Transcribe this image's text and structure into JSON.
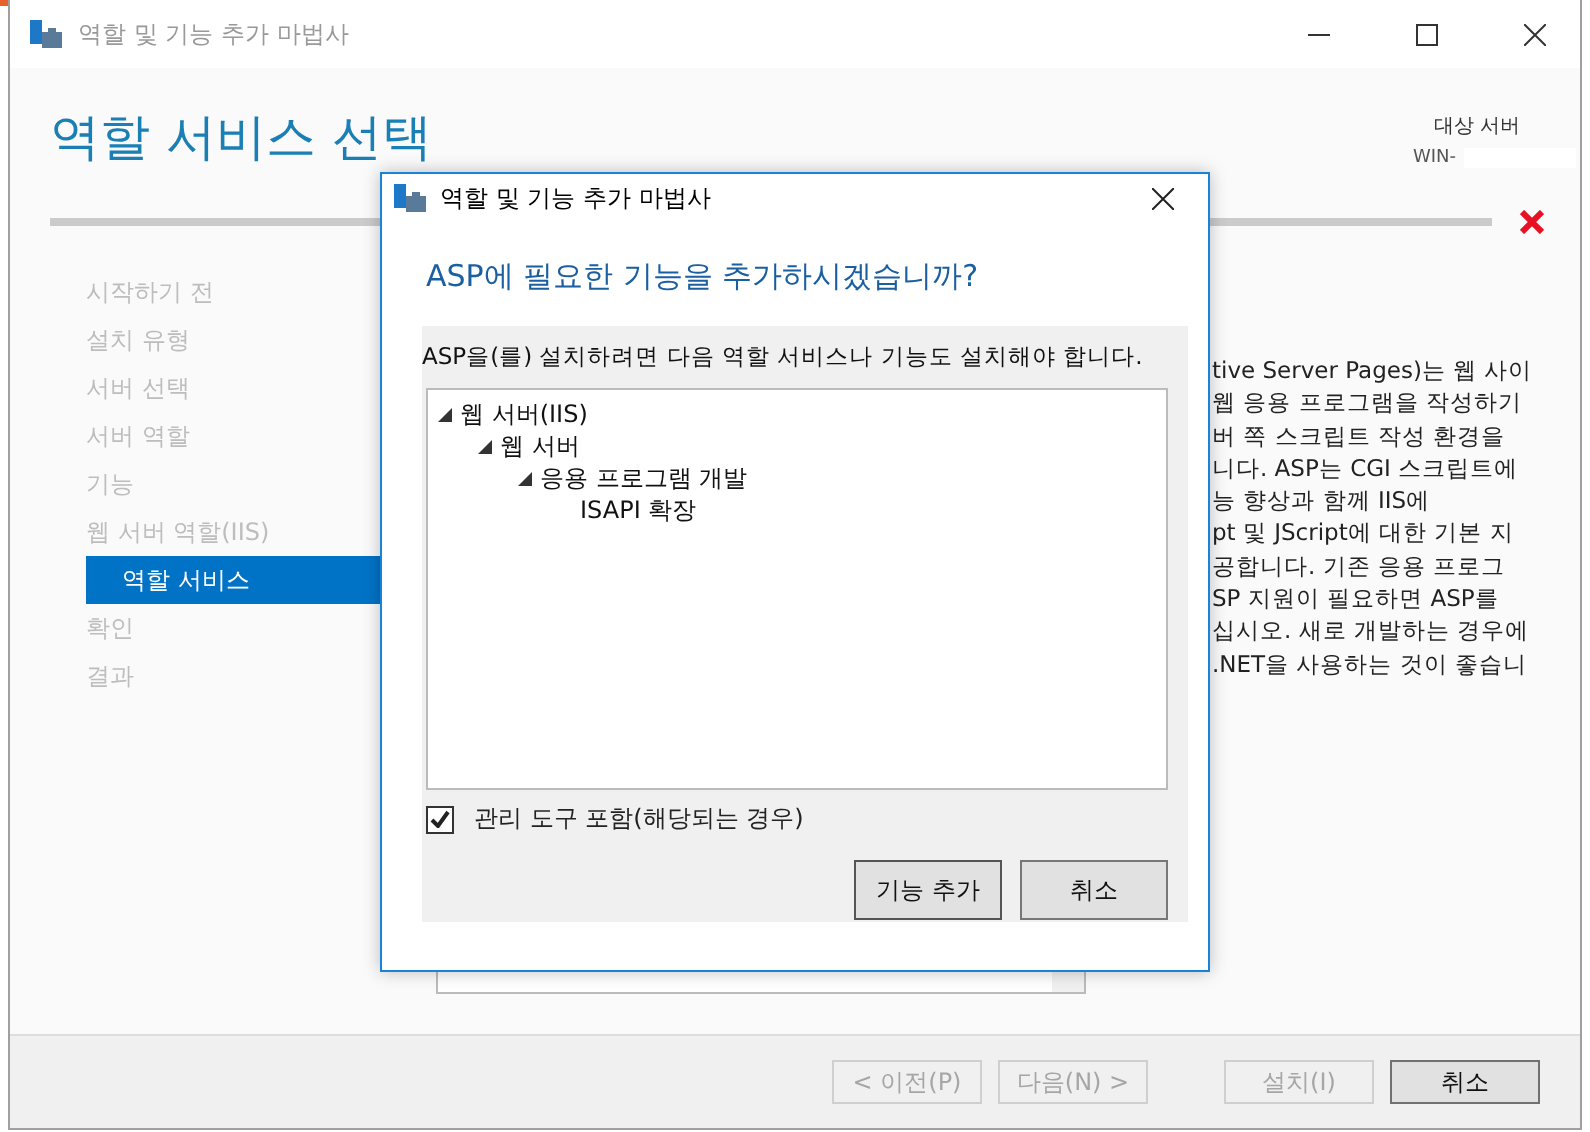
{
  "window": {
    "title": "역할 및 기능 추가 마법사"
  },
  "page_title": "역할 서비스 선택",
  "target_server": {
    "label": "대상 서버",
    "name": "WIN-"
  },
  "progress": {
    "error": true
  },
  "sidebar": {
    "items": [
      {
        "label": "시작하기 전",
        "selected": false,
        "sub": false
      },
      {
        "label": "설치 유형",
        "selected": false,
        "sub": false
      },
      {
        "label": "서버 선택",
        "selected": false,
        "sub": false
      },
      {
        "label": "서버 역할",
        "selected": false,
        "sub": false
      },
      {
        "label": "기능",
        "selected": false,
        "sub": false
      },
      {
        "label": "웹 서버 역할(IIS)",
        "selected": false,
        "sub": false
      },
      {
        "label": "역할 서비스",
        "selected": true,
        "sub": true
      },
      {
        "label": "확인",
        "selected": false,
        "sub": false
      },
      {
        "label": "결과",
        "selected": false,
        "sub": false
      }
    ]
  },
  "description": {
    "lines": [
      "tive Server Pages)는 웹 사이",
      "웹 응용 프로그램을 작성하기",
      "버 쪽 스크립트 작성 환경을",
      "니다. ASP는 CGI 스크립트에",
      "능 향상과 함께 IIS에",
      "pt 및 JScript에 대한 기본 지",
      "공합니다. 기존 응용 프로그",
      "SP 지원이 필요하면 ASP를",
      "십시오. 새로 개발하는 경우에",
      ".NET을 사용하는 것이 좋습니"
    ]
  },
  "footer": {
    "buttons": [
      {
        "label": "< 이전(P)",
        "disabled": true,
        "default": false
      },
      {
        "label": "다음(N) >",
        "disabled": true,
        "default": false
      },
      {
        "label": "설치(I)",
        "disabled": true,
        "default": false
      },
      {
        "label": "취소",
        "disabled": false,
        "default": true
      }
    ]
  },
  "dialog": {
    "title": "역할 및 기능 추가 마법사",
    "heading": "ASP에 필요한 기능을 추가하시겠습니까?",
    "message": "ASP을(를) 설치하려면 다음 역할 서비스나 기능도 설치해야 합니다.",
    "tree": [
      {
        "label": "웹 서버(IIS)",
        "expanded": true,
        "children": [
          {
            "label": "웹 서버",
            "expanded": true,
            "children": [
              {
                "label": "응용 프로그램 개발",
                "expanded": true,
                "children": [
                  {
                    "label": "ISAPI 확장"
                  }
                ]
              }
            ]
          }
        ]
      }
    ],
    "include_tools": {
      "label": "관리 도구 포함(해당되는 경우)",
      "checked": true
    },
    "buttons": [
      {
        "label": "기능 추가",
        "default": true
      },
      {
        "label": "취소",
        "default": false
      }
    ]
  }
}
